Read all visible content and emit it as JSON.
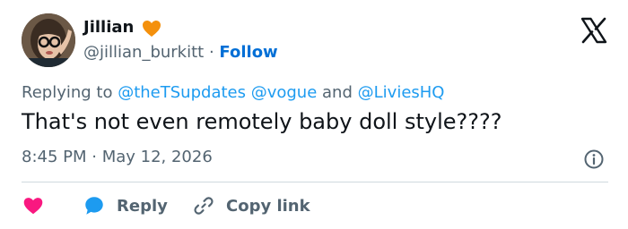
{
  "author": {
    "display_name": "Jillian",
    "badge_icon": "orange-heart-icon",
    "badge_color": "#f4900c",
    "handle": "@jillian_burkitt",
    "separator": "·",
    "follow_label": "Follow"
  },
  "brand_icon": "x-logo-icon",
  "reply_context": {
    "prefix": "Replying to",
    "mention_1": "@theTSupdates",
    "mention_2": "@vogue",
    "conjunction": "and",
    "mention_3": "@LiviesHQ"
  },
  "tweet": {
    "text": "That's not even remotely baby doll style????",
    "timestamp": "8:45 PM · May 12, 2026"
  },
  "actions": {
    "like_icon": "heart-icon",
    "reply_label": "Reply",
    "reply_icon": "speech-bubble-icon",
    "copy_label": "Copy link",
    "copy_icon": "link-icon"
  },
  "colors": {
    "accent": "#006fd6",
    "mention": "#1d9bf0",
    "like": "#f91880",
    "secondary_text": "#536471"
  }
}
